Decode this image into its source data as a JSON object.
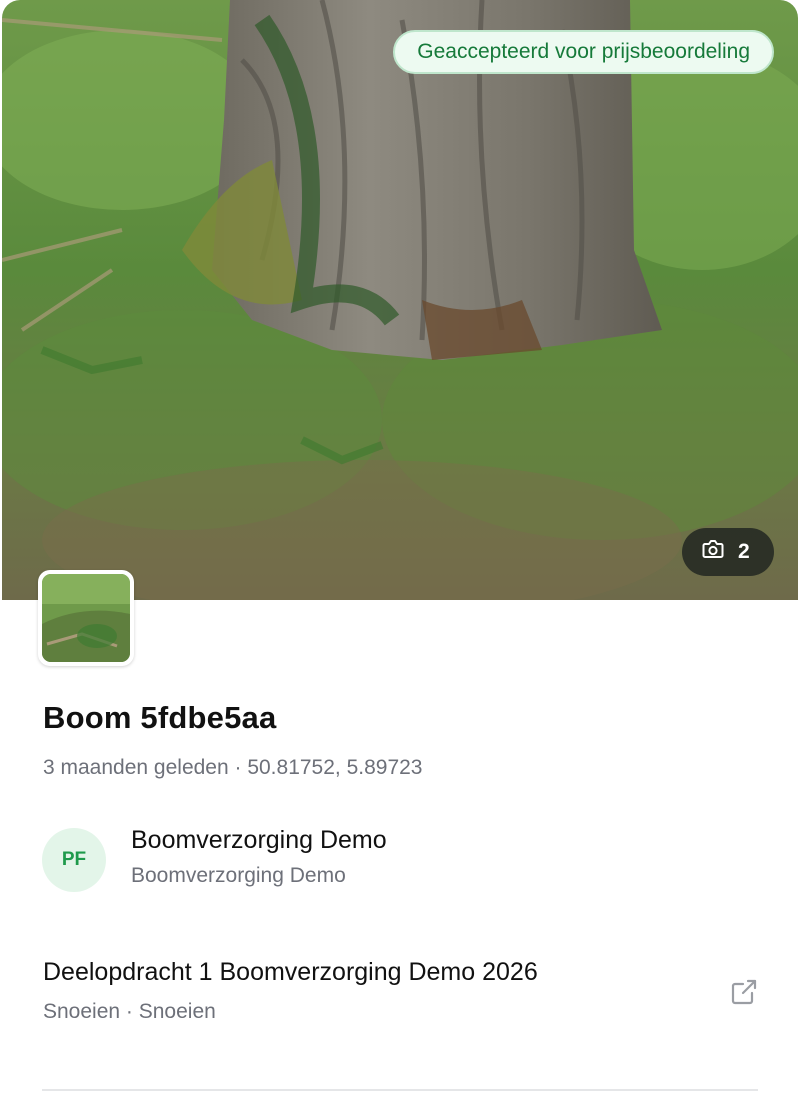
{
  "photo": {
    "status_badge": "Geaccepteerd voor prijsbeoordeling",
    "photo_count": "2",
    "icons": {
      "count": "camera-icon"
    }
  },
  "tree": {
    "title": "Boom 5fdbe5aa",
    "meta": "3 maanden geleden · 50.81752, 5.89723"
  },
  "organization": {
    "initials": "PF",
    "name": "Boomverzorging Demo",
    "subtitle": "Boomverzorging Demo"
  },
  "task": {
    "title": "Deelopdracht 1 Boomverzorging Demo 2026",
    "subtitle": "Snoeien · Snoeien",
    "icons": {
      "open": "external-link-icon"
    }
  },
  "colors": {
    "accent": "#167a3a",
    "badge_bg": "#edfaf1",
    "avatar_bg": "#e3f5e9",
    "muted_text": "#6d7079"
  }
}
